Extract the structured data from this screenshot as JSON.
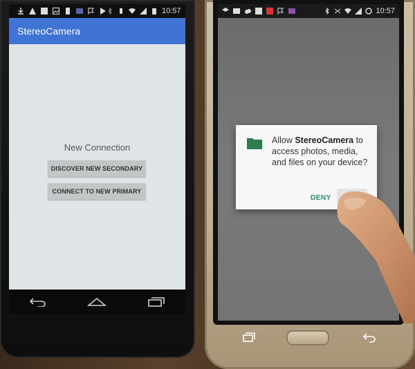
{
  "left_phone": {
    "status": {
      "time": "10:57"
    },
    "app": {
      "title": "StereoCamera"
    },
    "content": {
      "heading": "New Connection",
      "buttons": [
        {
          "label": "DISCOVER NEW SECONDARY"
        },
        {
          "label": "CONNECT TO NEW PRIMARY"
        }
      ]
    },
    "nav": {
      "icons": [
        "back-icon",
        "home-icon",
        "recents-icon"
      ]
    }
  },
  "right_phone": {
    "status": {
      "time": "10:57"
    },
    "dialog": {
      "prefix": "Allow ",
      "app_name": "StereoCamera",
      "suffix": " to access photos, media, and files on your device?",
      "deny_label": "DENY",
      "folder_color": "#2e7d4f"
    }
  },
  "colors": {
    "appbar": "#3f74d6",
    "button_bg": "#c2c6c6",
    "deny_text": "#2a8a70"
  }
}
